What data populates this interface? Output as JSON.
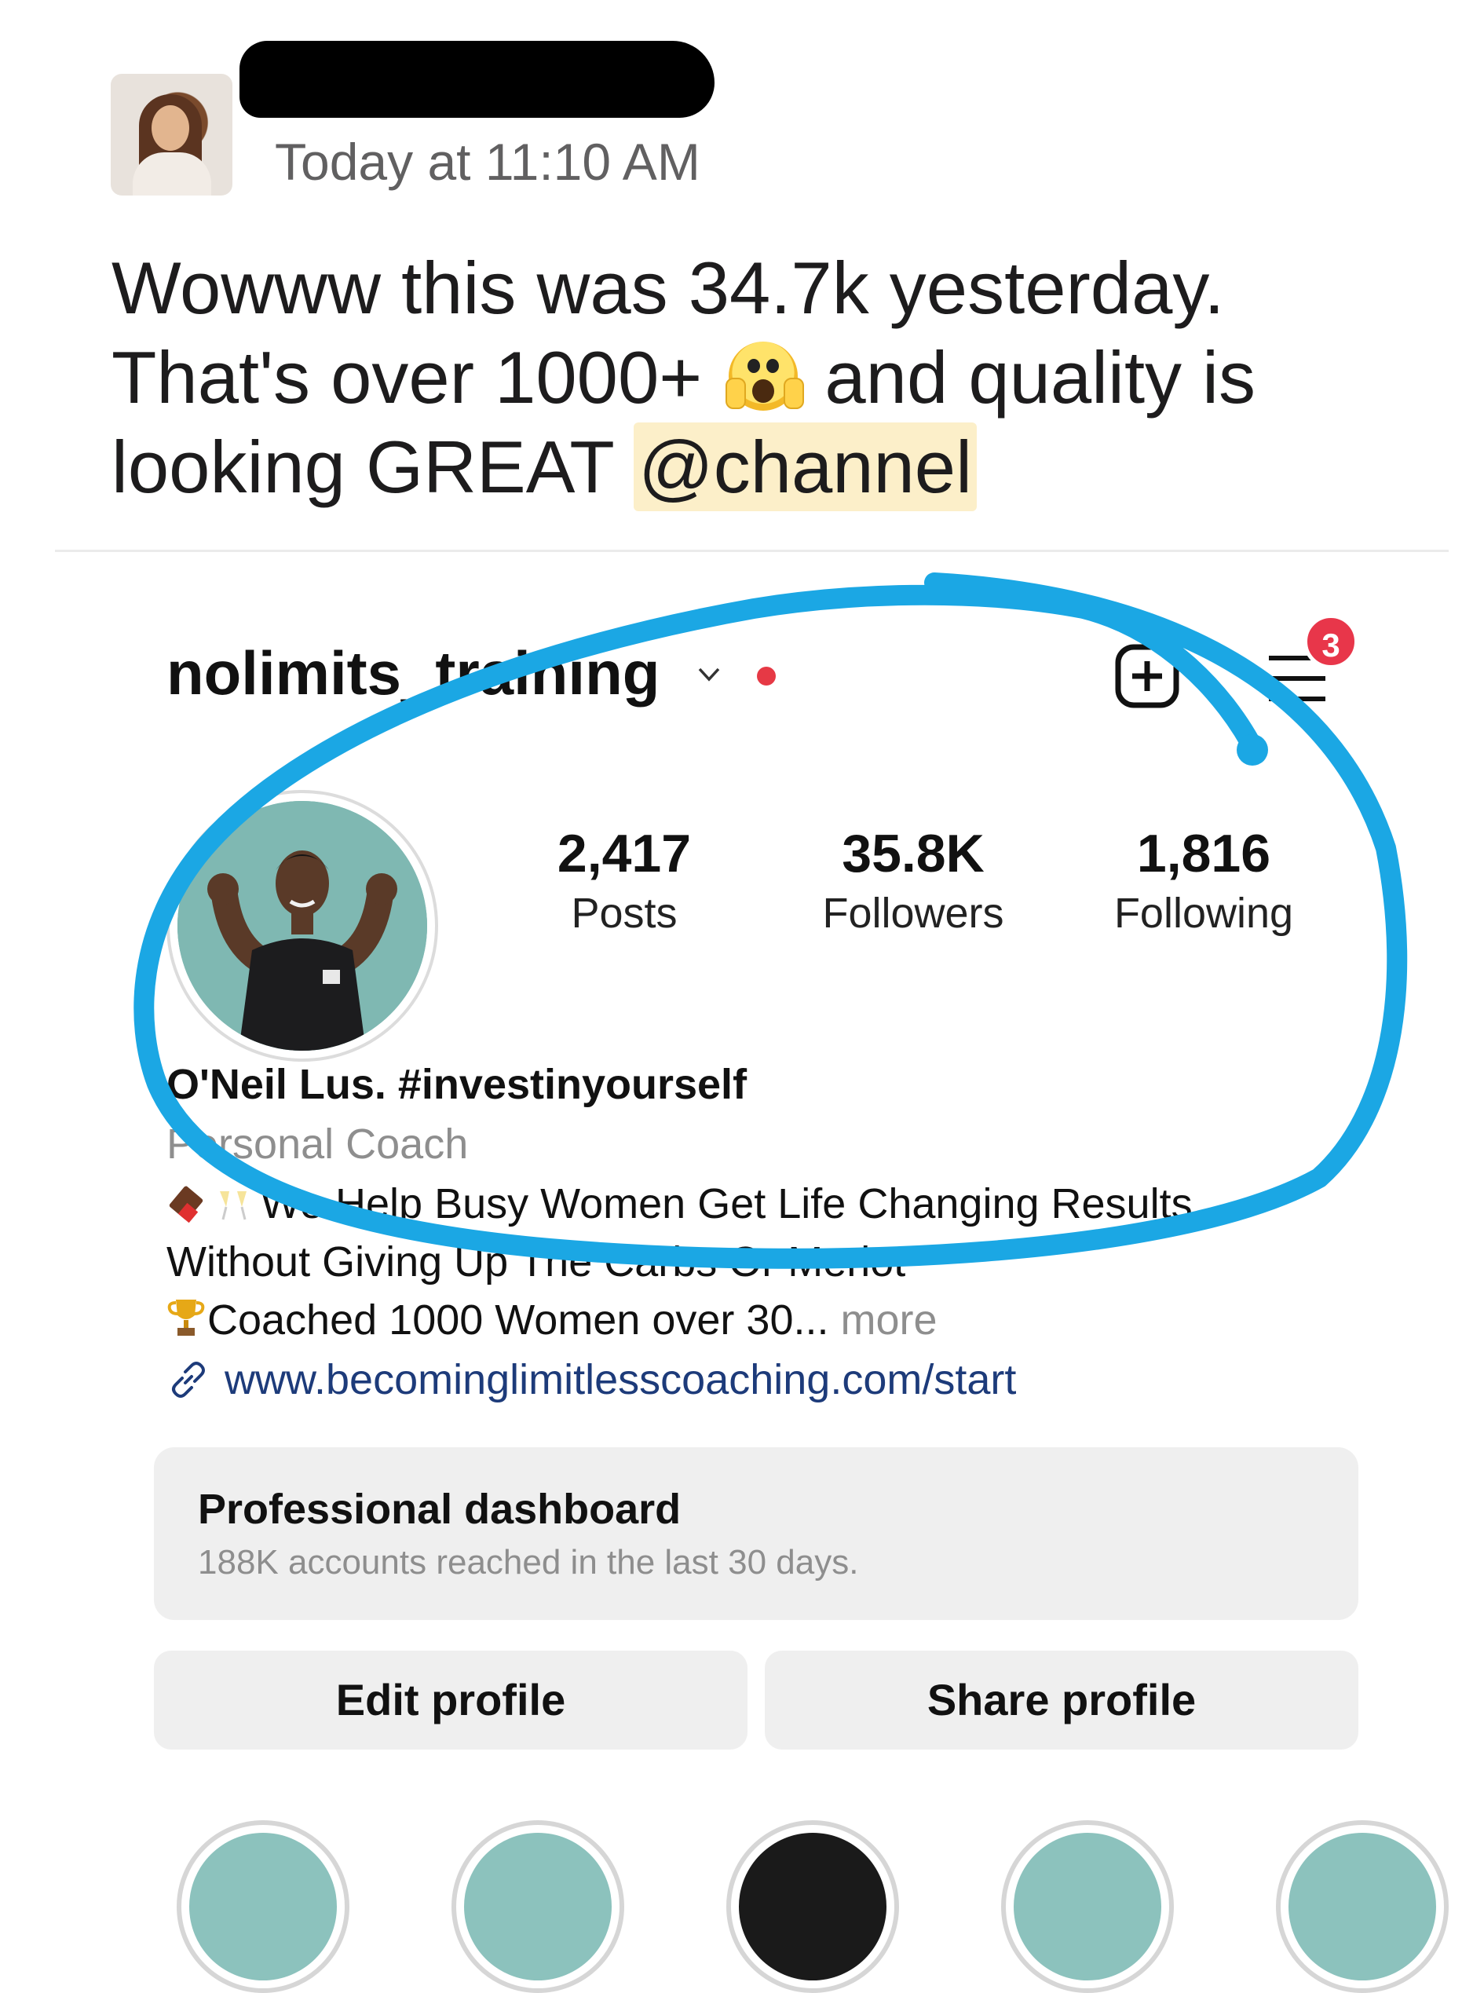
{
  "message": {
    "timestamp": "Today at 11:10 AM",
    "text_part1": "Wowww this was 34.7k yesterday. That's over 1000+",
    "emoji_icon": "face-screaming-in-fear-icon",
    "text_part2": "and quality is looking GREAT",
    "mention": "@channel"
  },
  "profile": {
    "username": "nolimits_training",
    "notification_count": "3",
    "stats": [
      {
        "value": "2,417",
        "label": "Posts"
      },
      {
        "value": "35.8K",
        "label": "Followers"
      },
      {
        "value": "1,816",
        "label": "Following"
      }
    ],
    "bio_name": "O'Neil Lus. #investinyourself",
    "category": "Personal Coach",
    "bio_line1": "We Help Busy Women Get Life Changing Results",
    "bio_line2": "Without Giving Up The Carbs Or Merlot",
    "bio_line3": "Coached 1000 Women over 30...",
    "bio_more": "more",
    "link": "www.becominglimitlesscoaching.com/start"
  },
  "dashboard": {
    "title": "Professional dashboard",
    "subtitle": "188K accounts reached in the last 30 days."
  },
  "buttons": {
    "edit_profile": "Edit profile",
    "share_profile": "Share profile"
  },
  "colors": {
    "annotation_stroke": "#1ba7e4",
    "mention_bg": "#fcefc9",
    "notification_badge": "#e8364a",
    "link": "#1d3b7a"
  }
}
